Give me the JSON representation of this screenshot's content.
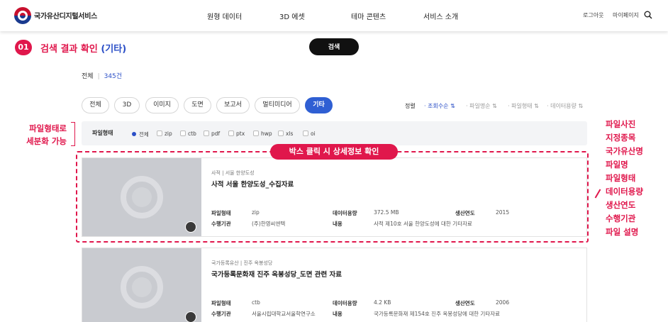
{
  "header": {
    "brand": "국가유산디지털서비스",
    "nav": [
      "원형 데이터",
      "3D 에셋",
      "테마 콘텐츠",
      "서비스 소개"
    ],
    "login": "로그아웃",
    "mypage": "마이페이지"
  },
  "step": {
    "number": "01",
    "title": "검색 결과 확인",
    "title_sub": "(기타)",
    "search_button": "검색"
  },
  "summary": {
    "label": "전체",
    "count": "345건"
  },
  "tabs": [
    "전체",
    "3D",
    "이미지",
    "도면",
    "보고서",
    "멀티미디어",
    "기타"
  ],
  "active_tab": "기타",
  "sort": {
    "label": "정렬",
    "options": [
      "조회수순",
      "파일명순",
      "파일형태",
      "데이터용량"
    ],
    "selected": "조회수순"
  },
  "filter": {
    "label": "파일형태",
    "options": [
      "전체",
      "zip",
      "ctb",
      "pdf",
      "ptx",
      "hwp",
      "xls",
      "oi"
    ],
    "selected": "전체"
  },
  "annotations": {
    "left_lines": [
      "파일형태로",
      "세분화 가능"
    ],
    "box_pill": "박스 클릭 시 상세정보 확인",
    "right_lines": [
      "파일사진",
      "지정종목",
      "국가유산명",
      "파일명",
      "파일형태",
      "데이터용량",
      "생산연도",
      "수행기관",
      "파일 설명"
    ]
  },
  "field_labels": {
    "file_type": "파일형태",
    "data_size": "데이터용량",
    "year": "생산연도",
    "agency": "수행기관",
    "content": "내용"
  },
  "results": [
    {
      "category": "사적",
      "location": "서울 한양도성",
      "title": "사적 서울 한양도성_수집자료",
      "file_type": "zip",
      "data_size": "372.5 MB",
      "year": "2015",
      "agency": "(주)한영씨엔텍",
      "content": "사적 제10호 서울 한양도성에 대한 기타자료"
    },
    {
      "category": "국가등록유산",
      "location": "진주 옥봉성당",
      "title": "국가등록문화재 진주 옥봉성당_도면 관련 자료",
      "file_type": "ctb",
      "data_size": "4.2 KB",
      "year": "2006",
      "agency": "서울시립대학교서울학연구소",
      "content": "국가등록문화재 제154호 진주 옥봉성당에 대한 기타자료"
    }
  ],
  "colors": {
    "accent": "#e0174c",
    "primary": "#2f5fd3",
    "thumb": "#c9cbd0"
  }
}
